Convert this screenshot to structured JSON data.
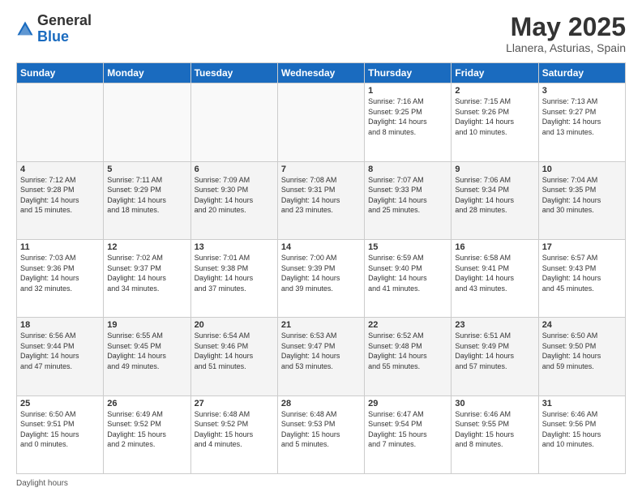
{
  "header": {
    "logo_general": "General",
    "logo_blue": "Blue",
    "month_title": "May 2025",
    "location": "Llanera, Asturias, Spain"
  },
  "weekdays": [
    "Sunday",
    "Monday",
    "Tuesday",
    "Wednesday",
    "Thursday",
    "Friday",
    "Saturday"
  ],
  "footer": {
    "daylight_label": "Daylight hours"
  },
  "weeks": [
    [
      {
        "day": "",
        "info": ""
      },
      {
        "day": "",
        "info": ""
      },
      {
        "day": "",
        "info": ""
      },
      {
        "day": "",
        "info": ""
      },
      {
        "day": "1",
        "info": "Sunrise: 7:16 AM\nSunset: 9:25 PM\nDaylight: 14 hours\nand 8 minutes."
      },
      {
        "day": "2",
        "info": "Sunrise: 7:15 AM\nSunset: 9:26 PM\nDaylight: 14 hours\nand 10 minutes."
      },
      {
        "day": "3",
        "info": "Sunrise: 7:13 AM\nSunset: 9:27 PM\nDaylight: 14 hours\nand 13 minutes."
      }
    ],
    [
      {
        "day": "4",
        "info": "Sunrise: 7:12 AM\nSunset: 9:28 PM\nDaylight: 14 hours\nand 15 minutes."
      },
      {
        "day": "5",
        "info": "Sunrise: 7:11 AM\nSunset: 9:29 PM\nDaylight: 14 hours\nand 18 minutes."
      },
      {
        "day": "6",
        "info": "Sunrise: 7:09 AM\nSunset: 9:30 PM\nDaylight: 14 hours\nand 20 minutes."
      },
      {
        "day": "7",
        "info": "Sunrise: 7:08 AM\nSunset: 9:31 PM\nDaylight: 14 hours\nand 23 minutes."
      },
      {
        "day": "8",
        "info": "Sunrise: 7:07 AM\nSunset: 9:33 PM\nDaylight: 14 hours\nand 25 minutes."
      },
      {
        "day": "9",
        "info": "Sunrise: 7:06 AM\nSunset: 9:34 PM\nDaylight: 14 hours\nand 28 minutes."
      },
      {
        "day": "10",
        "info": "Sunrise: 7:04 AM\nSunset: 9:35 PM\nDaylight: 14 hours\nand 30 minutes."
      }
    ],
    [
      {
        "day": "11",
        "info": "Sunrise: 7:03 AM\nSunset: 9:36 PM\nDaylight: 14 hours\nand 32 minutes."
      },
      {
        "day": "12",
        "info": "Sunrise: 7:02 AM\nSunset: 9:37 PM\nDaylight: 14 hours\nand 34 minutes."
      },
      {
        "day": "13",
        "info": "Sunrise: 7:01 AM\nSunset: 9:38 PM\nDaylight: 14 hours\nand 37 minutes."
      },
      {
        "day": "14",
        "info": "Sunrise: 7:00 AM\nSunset: 9:39 PM\nDaylight: 14 hours\nand 39 minutes."
      },
      {
        "day": "15",
        "info": "Sunrise: 6:59 AM\nSunset: 9:40 PM\nDaylight: 14 hours\nand 41 minutes."
      },
      {
        "day": "16",
        "info": "Sunrise: 6:58 AM\nSunset: 9:41 PM\nDaylight: 14 hours\nand 43 minutes."
      },
      {
        "day": "17",
        "info": "Sunrise: 6:57 AM\nSunset: 9:43 PM\nDaylight: 14 hours\nand 45 minutes."
      }
    ],
    [
      {
        "day": "18",
        "info": "Sunrise: 6:56 AM\nSunset: 9:44 PM\nDaylight: 14 hours\nand 47 minutes."
      },
      {
        "day": "19",
        "info": "Sunrise: 6:55 AM\nSunset: 9:45 PM\nDaylight: 14 hours\nand 49 minutes."
      },
      {
        "day": "20",
        "info": "Sunrise: 6:54 AM\nSunset: 9:46 PM\nDaylight: 14 hours\nand 51 minutes."
      },
      {
        "day": "21",
        "info": "Sunrise: 6:53 AM\nSunset: 9:47 PM\nDaylight: 14 hours\nand 53 minutes."
      },
      {
        "day": "22",
        "info": "Sunrise: 6:52 AM\nSunset: 9:48 PM\nDaylight: 14 hours\nand 55 minutes."
      },
      {
        "day": "23",
        "info": "Sunrise: 6:51 AM\nSunset: 9:49 PM\nDaylight: 14 hours\nand 57 minutes."
      },
      {
        "day": "24",
        "info": "Sunrise: 6:50 AM\nSunset: 9:50 PM\nDaylight: 14 hours\nand 59 minutes."
      }
    ],
    [
      {
        "day": "25",
        "info": "Sunrise: 6:50 AM\nSunset: 9:51 PM\nDaylight: 15 hours\nand 0 minutes."
      },
      {
        "day": "26",
        "info": "Sunrise: 6:49 AM\nSunset: 9:52 PM\nDaylight: 15 hours\nand 2 minutes."
      },
      {
        "day": "27",
        "info": "Sunrise: 6:48 AM\nSunset: 9:52 PM\nDaylight: 15 hours\nand 4 minutes."
      },
      {
        "day": "28",
        "info": "Sunrise: 6:48 AM\nSunset: 9:53 PM\nDaylight: 15 hours\nand 5 minutes."
      },
      {
        "day": "29",
        "info": "Sunrise: 6:47 AM\nSunset: 9:54 PM\nDaylight: 15 hours\nand 7 minutes."
      },
      {
        "day": "30",
        "info": "Sunrise: 6:46 AM\nSunset: 9:55 PM\nDaylight: 15 hours\nand 8 minutes."
      },
      {
        "day": "31",
        "info": "Sunrise: 6:46 AM\nSunset: 9:56 PM\nDaylight: 15 hours\nand 10 minutes."
      }
    ]
  ]
}
